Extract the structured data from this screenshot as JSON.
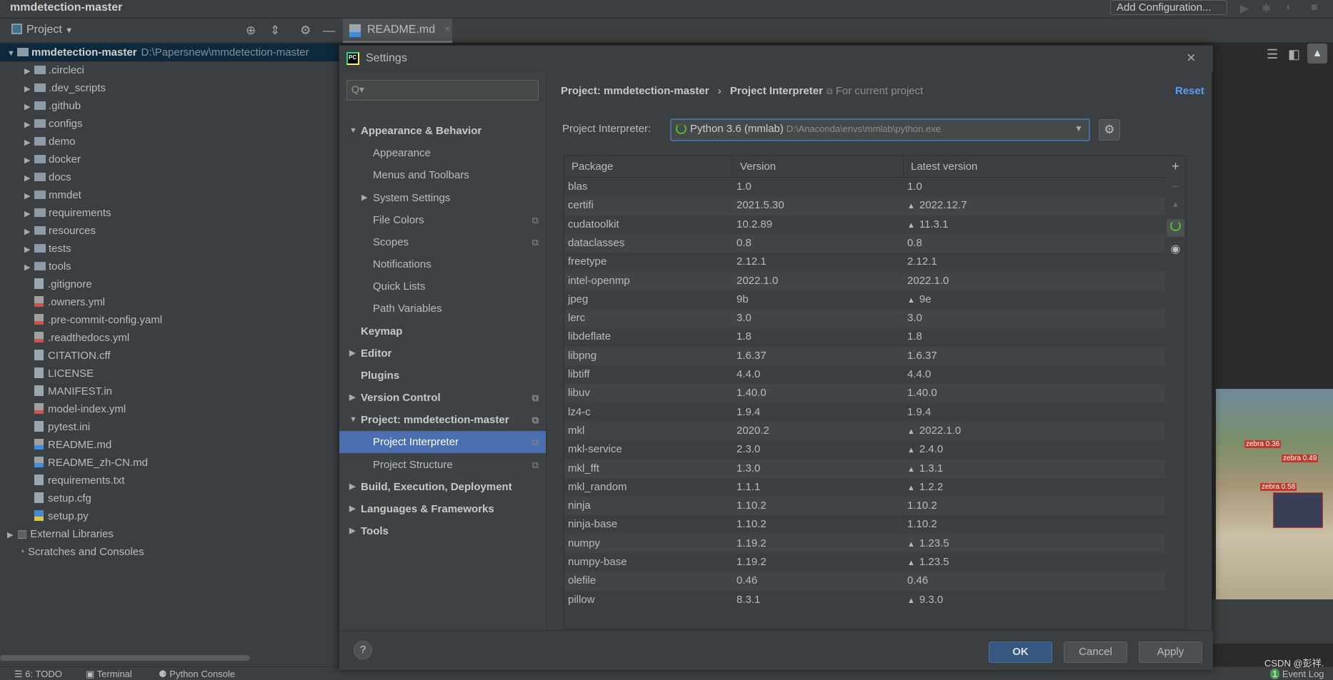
{
  "window": {
    "title": "mmdetection-master",
    "add_configuration": "Add Configuration..."
  },
  "toolbar": {
    "project_label": "Project",
    "editor_tab": "README.md"
  },
  "tree": [
    {
      "name": "mmdetection-master",
      "path": "D:\\Papersnew\\mmdetection-master",
      "type": "root"
    },
    {
      "name": ".circleci",
      "type": "folder"
    },
    {
      "name": ".dev_scripts",
      "type": "folder"
    },
    {
      "name": ".github",
      "type": "folder"
    },
    {
      "name": "configs",
      "type": "folder"
    },
    {
      "name": "demo",
      "type": "folder"
    },
    {
      "name": "docker",
      "type": "folder"
    },
    {
      "name": "docs",
      "type": "folder"
    },
    {
      "name": "mmdet",
      "type": "folder"
    },
    {
      "name": "requirements",
      "type": "folder"
    },
    {
      "name": "resources",
      "type": "folder"
    },
    {
      "name": "tests",
      "type": "folder"
    },
    {
      "name": "tools",
      "type": "folder"
    },
    {
      "name": ".gitignore",
      "type": "file"
    },
    {
      "name": ".owners.yml",
      "type": "yml"
    },
    {
      "name": ".pre-commit-config.yaml",
      "type": "yml"
    },
    {
      "name": ".readthedocs.yml",
      "type": "yml"
    },
    {
      "name": "CITATION.cff",
      "type": "file"
    },
    {
      "name": "LICENSE",
      "type": "file"
    },
    {
      "name": "MANIFEST.in",
      "type": "file"
    },
    {
      "name": "model-index.yml",
      "type": "yml"
    },
    {
      "name": "pytest.ini",
      "type": "file"
    },
    {
      "name": "README.md",
      "type": "md"
    },
    {
      "name": "README_zh-CN.md",
      "type": "md"
    },
    {
      "name": "requirements.txt",
      "type": "file"
    },
    {
      "name": "setup.cfg",
      "type": "file"
    },
    {
      "name": "setup.py",
      "type": "py"
    },
    {
      "name": "External Libraries",
      "type": "lib"
    },
    {
      "name": "Scratches and Consoles",
      "type": "scratch"
    }
  ],
  "statusbar": {
    "todo": "6: TODO",
    "terminal": "Terminal",
    "python_console": "Python Console",
    "watermark": "CSDN @彭祥.",
    "event_log": "Event Log",
    "event_count": "1"
  },
  "image_labels": [
    "zebra|0.36",
    "zebra|0.49",
    "zebra|0.58"
  ],
  "dialog": {
    "title": "Settings",
    "search_placeholder": "Q▾",
    "sidebar": [
      {
        "label": "Appearance & Behavior",
        "level": 0,
        "bold": true,
        "arrow": "down"
      },
      {
        "label": "Appearance",
        "level": 1
      },
      {
        "label": "Menus and Toolbars",
        "level": 1
      },
      {
        "label": "System Settings",
        "level": 1,
        "arrow": "right"
      },
      {
        "label": "File Colors",
        "level": 1,
        "copy": true
      },
      {
        "label": "Scopes",
        "level": 1,
        "copy": true
      },
      {
        "label": "Notifications",
        "level": 1
      },
      {
        "label": "Quick Lists",
        "level": 1
      },
      {
        "label": "Path Variables",
        "level": 1
      },
      {
        "label": "Keymap",
        "level": 0,
        "bold": true
      },
      {
        "label": "Editor",
        "level": 0,
        "bold": true,
        "arrow": "right"
      },
      {
        "label": "Plugins",
        "level": 0,
        "bold": true
      },
      {
        "label": "Version Control",
        "level": 0,
        "bold": true,
        "arrow": "right",
        "copy": true
      },
      {
        "label": "Project: mmdetection-master",
        "level": 0,
        "bold": true,
        "arrow": "down",
        "copy": true
      },
      {
        "label": "Project Interpreter",
        "level": 1,
        "copy": true,
        "selected": true
      },
      {
        "label": "Project Structure",
        "level": 1,
        "copy": true
      },
      {
        "label": "Build, Execution, Deployment",
        "level": 0,
        "bold": true,
        "arrow": "right"
      },
      {
        "label": "Languages & Frameworks",
        "level": 0,
        "bold": true,
        "arrow": "right"
      },
      {
        "label": "Tools",
        "level": 0,
        "bold": true,
        "arrow": "right"
      }
    ],
    "breadcrumb": {
      "parent": "Project: mmdetection-master",
      "separator": "›",
      "current": "Project Interpreter"
    },
    "for_current_project": "For current project",
    "reset": "Reset",
    "interpreter_label": "Project Interpreter:",
    "interpreter_name": "Python 3.6 (mmlab)",
    "interpreter_path": "D:\\Anaconda\\envs\\mmlab\\python.exe",
    "columns": [
      "Package",
      "Version",
      "Latest version"
    ],
    "packages": [
      [
        "blas",
        "1.0",
        "1.0",
        false
      ],
      [
        "certifi",
        "2021.5.30",
        "2022.12.7",
        true
      ],
      [
        "cudatoolkit",
        "10.2.89",
        "11.3.1",
        true
      ],
      [
        "dataclasses",
        "0.8",
        "0.8",
        false
      ],
      [
        "freetype",
        "2.12.1",
        "2.12.1",
        false
      ],
      [
        "intel-openmp",
        "2022.1.0",
        "2022.1.0",
        false
      ],
      [
        "jpeg",
        "9b",
        "9e",
        true
      ],
      [
        "lerc",
        "3.0",
        "3.0",
        false
      ],
      [
        "libdeflate",
        "1.8",
        "1.8",
        false
      ],
      [
        "libpng",
        "1.6.37",
        "1.6.37",
        false
      ],
      [
        "libtiff",
        "4.4.0",
        "4.4.0",
        false
      ],
      [
        "libuv",
        "1.40.0",
        "1.40.0",
        false
      ],
      [
        "lz4-c",
        "1.9.4",
        "1.9.4",
        false
      ],
      [
        "mkl",
        "2020.2",
        "2022.1.0",
        true
      ],
      [
        "mkl-service",
        "2.3.0",
        "2.4.0",
        true
      ],
      [
        "mkl_fft",
        "1.3.0",
        "1.3.1",
        true
      ],
      [
        "mkl_random",
        "1.1.1",
        "1.2.2",
        true
      ],
      [
        "ninja",
        "1.10.2",
        "1.10.2",
        false
      ],
      [
        "ninja-base",
        "1.10.2",
        "1.10.2",
        false
      ],
      [
        "numpy",
        "1.19.2",
        "1.23.5",
        true
      ],
      [
        "numpy-base",
        "1.19.2",
        "1.23.5",
        true
      ],
      [
        "olefile",
        "0.46",
        "0.46",
        false
      ],
      [
        "pillow",
        "8.3.1",
        "9.3.0",
        true
      ]
    ],
    "buttons": {
      "ok": "OK",
      "cancel": "Cancel",
      "apply": "Apply",
      "help": "?"
    },
    "colors": {
      "accent": "#4b6eaf",
      "ok_button": "#365880",
      "link": "#589df6",
      "spinner": "#5fb832"
    }
  }
}
